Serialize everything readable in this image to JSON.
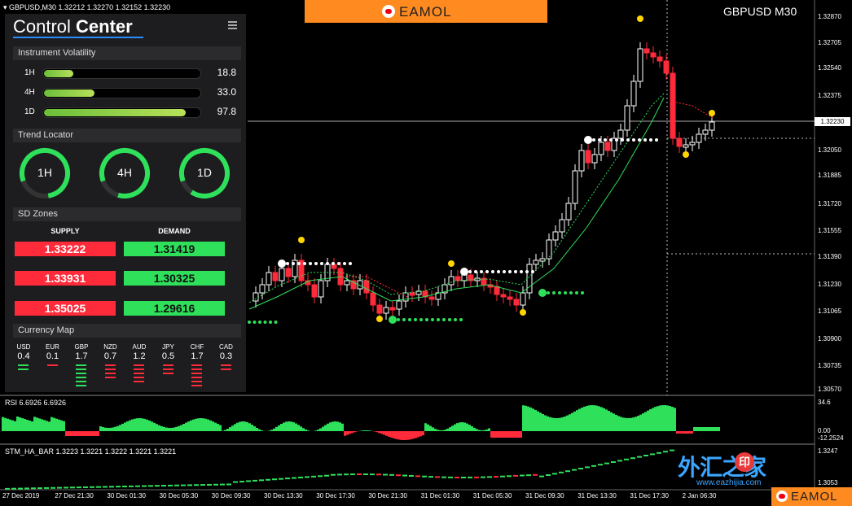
{
  "header": {
    "ohlc_info": "GBPUSD,M30  1.32212 1.32270 1.32152 1.32230",
    "symbol_timeframe": "GBPUSD M30",
    "brand": "EAMOL"
  },
  "panel": {
    "title_regular": "Control ",
    "title_bold": "Center",
    "volatility": {
      "title": "Instrument Volatility",
      "rows": [
        {
          "label": "1H",
          "value": "18.8",
          "fill": 0.19
        },
        {
          "label": "4H",
          "value": "33.0",
          "fill": 0.33
        },
        {
          "label": "1D",
          "value": "97.8",
          "fill": 0.92
        }
      ]
    },
    "trend": {
      "title": "Trend Locator",
      "gauges": [
        {
          "label": "1H",
          "fill": 0.78
        },
        {
          "label": "4H",
          "fill": 0.85
        },
        {
          "label": "1D",
          "fill": 0.9
        }
      ]
    },
    "sd_zones": {
      "title": "SD Zones",
      "supply_header": "SUPPLY",
      "demand_header": "DEMAND",
      "supply": [
        "1.33222",
        "1.33931",
        "1.35025"
      ],
      "demand": [
        "1.31419",
        "1.30325",
        "1.29616"
      ]
    },
    "currency_map": {
      "title": "Currency Map",
      "currencies": [
        {
          "code": "USD",
          "value": "0.4",
          "bars": 2,
          "color": "#2ee05a"
        },
        {
          "code": "EUR",
          "value": "0.1",
          "bars": 1,
          "color": "#ff2a3a"
        },
        {
          "code": "GBP",
          "value": "1.7",
          "bars": 6,
          "color": "#2ee05a"
        },
        {
          "code": "NZD",
          "value": "0.7",
          "bars": 4,
          "color": "#ff2a3a"
        },
        {
          "code": "AUD",
          "value": "1.2",
          "bars": 5,
          "color": "#ff2a3a"
        },
        {
          "code": "JPY",
          "value": "0.5",
          "bars": 3,
          "color": "#ff2a3a"
        },
        {
          "code": "CHF",
          "value": "1.7",
          "bars": 6,
          "color": "#ff2a3a"
        },
        {
          "code": "CAD",
          "value": "0.3",
          "bars": 2,
          "color": "#ff2a3a"
        }
      ]
    }
  },
  "price_axis": [
    "1.32870",
    "1.32705",
    "1.32540",
    "1.32375",
    "1.32050",
    "1.31885",
    "1.31720",
    "1.31555",
    "1.31390",
    "1.31230",
    "1.31065",
    "1.30900",
    "1.30735",
    "1.30570"
  ],
  "current_price": "1.32230",
  "rsi": {
    "label": "RSI 6.6926 6.6926",
    "axis": [
      "34.6",
      "0.00",
      "-12.2524"
    ]
  },
  "stm": {
    "label": "STM_HA_BAR 1.3223 1.3221 1.3222 1.3221 1.3221",
    "axis": [
      "1.3247",
      "1.3053"
    ]
  },
  "time_axis": [
    "27 Dec 2019",
    "27 Dec 21:30",
    "30 Dec 01:30",
    "30 Dec 05:30",
    "30 Dec 09:30",
    "30 Dec 13:30",
    "30 Dec 17:30",
    "30 Dec 21:30",
    "31 Dec 01:30",
    "31 Dec 05:30",
    "31 Dec 09:30",
    "31 Dec 13:30",
    "31 Dec 17:30",
    "2 Jan 06:30"
  ],
  "watermark": {
    "cn": "外汇之家",
    "seal": "印",
    "url": "www.eazhijia.com"
  },
  "colors": {
    "bull": "#2ee05a",
    "bear": "#ff2a3a",
    "accent": "#ff8a1f",
    "up_candle": "#ffffff",
    "down_candle": "#ff2a3a"
  },
  "chart_data": {
    "type": "candlestick",
    "series": [
      {
        "name": "GBPUSD M30",
        "close_levels": [
          1.3111,
          1.3123,
          1.3132,
          1.3141,
          1.3129,
          1.3118,
          1.3108,
          1.3112,
          1.312,
          1.3131,
          1.3141,
          1.313,
          1.3118,
          1.3123,
          1.316,
          1.3185,
          1.321,
          1.3225,
          1.3248,
          1.3275,
          1.325,
          1.3205,
          1.3223
        ]
      }
    ],
    "ylim": [
      1.3057,
      1.329
    ]
  }
}
